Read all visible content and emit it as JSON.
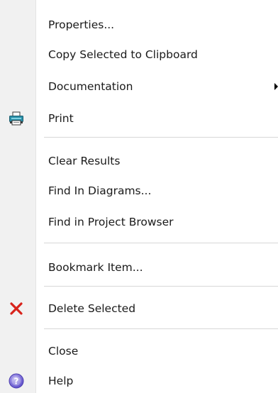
{
  "menu": {
    "items": [
      {
        "label": "Properties..."
      },
      {
        "label": "Copy Selected to Clipboard"
      },
      {
        "label": "Documentation"
      },
      {
        "label": "Print",
        "icon": "printer-icon"
      },
      {
        "label": "Clear Results"
      },
      {
        "label": "Find In Diagrams..."
      },
      {
        "label": "Find in Project Browser"
      },
      {
        "label": "Bookmark Item..."
      },
      {
        "label": "Delete Selected",
        "icon": "delete-x-icon"
      },
      {
        "label": "Close"
      },
      {
        "label": "Help",
        "icon": "help-icon"
      }
    ]
  },
  "colors": {
    "delete_red": "#d8231b",
    "help_purple": "#6b5ad6",
    "printer_teal": "#2a8fa8"
  }
}
